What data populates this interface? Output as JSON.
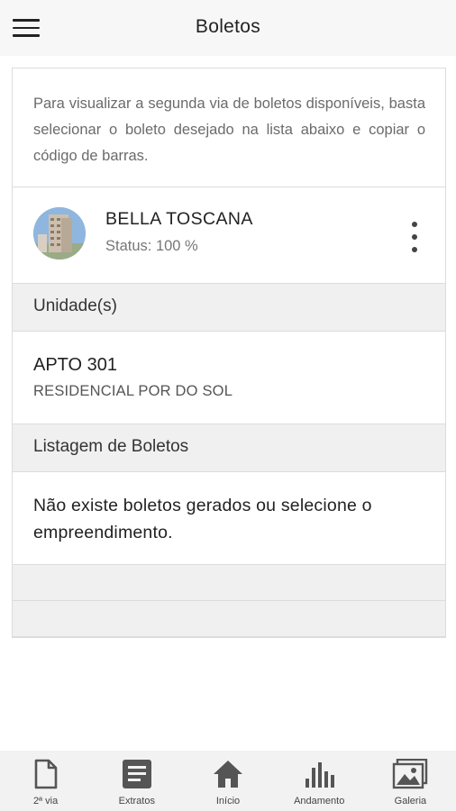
{
  "header": {
    "title": "Boletos",
    "menu_icon": "hamburger-menu-icon"
  },
  "intro": {
    "text": "Para visualizar a segunda via de boletos disponíveis, basta selecionar o boleto desejado na lista abaixo e copiar o código de barras."
  },
  "project": {
    "name": "BELLA TOSCANA",
    "status": "Status: 100 %",
    "more_icon": "more-vertical-icon"
  },
  "units_section": {
    "title": "Unidade(s)"
  },
  "unit": {
    "name": "APTO 301",
    "building": "RESIDENCIAL POR DO SOL"
  },
  "boletos_section": {
    "title": "Listagem de Boletos"
  },
  "empty_message": "Não existe boletos gerados ou selecione o empreendimento.",
  "bottom_nav": [
    {
      "label": "2ª via",
      "icon": "document-icon"
    },
    {
      "label": "Extratos",
      "icon": "list-icon"
    },
    {
      "label": "Início",
      "icon": "home-icon"
    },
    {
      "label": "Andamento",
      "icon": "bar-chart-icon"
    },
    {
      "label": "Galeria",
      "icon": "gallery-icon"
    }
  ],
  "colors": {
    "header_bg": "#f7f7f7",
    "section_bg": "#f0f0f0",
    "nav_bg": "#f2f2f2",
    "border": "#dcdcdc",
    "icon": "#555555"
  }
}
